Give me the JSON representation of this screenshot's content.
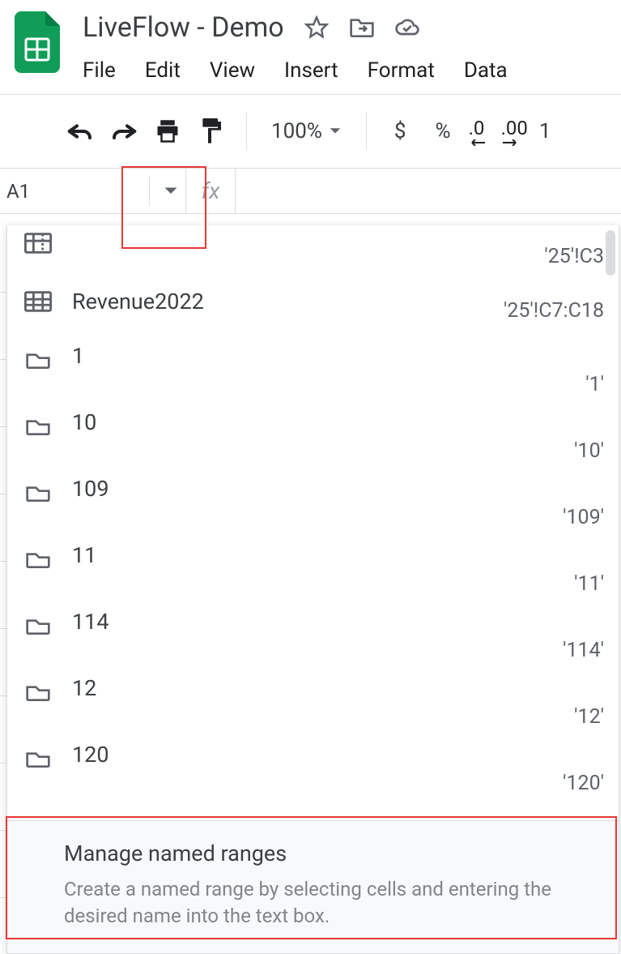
{
  "header": {
    "doc_title": "LiveFlow - Demo",
    "menus": [
      "File",
      "Edit",
      "View",
      "Insert",
      "Format",
      "Data"
    ]
  },
  "toolbar": {
    "zoom": "100%",
    "currency": "$",
    "percent": "%",
    "dec_minus": ".0",
    "dec_plus": ".00",
    "num_format_tail": "1"
  },
  "namebox": {
    "value": "A1",
    "fx": "fx"
  },
  "dropdown": {
    "items": [
      {
        "icon": "range-grid-partial",
        "label": "",
        "ref": "'25'!C3"
      },
      {
        "icon": "range-grid",
        "label": "Revenue2022",
        "ref": "'25'!C7:C18"
      },
      {
        "icon": "sheet",
        "label": "1",
        "ref": "'1'"
      },
      {
        "icon": "sheet",
        "label": "10",
        "ref": "'10'"
      },
      {
        "icon": "sheet",
        "label": "109",
        "ref": "'109'"
      },
      {
        "icon": "sheet",
        "label": "11",
        "ref": "'11'"
      },
      {
        "icon": "sheet",
        "label": "114",
        "ref": "'114'"
      },
      {
        "icon": "sheet",
        "label": "12",
        "ref": "'12'"
      },
      {
        "icon": "sheet",
        "label": "120",
        "ref": "'120'"
      }
    ],
    "footer": {
      "title": "Manage named ranges",
      "desc": "Create a named range by selecting cells and entering the desired name into the text box."
    }
  }
}
